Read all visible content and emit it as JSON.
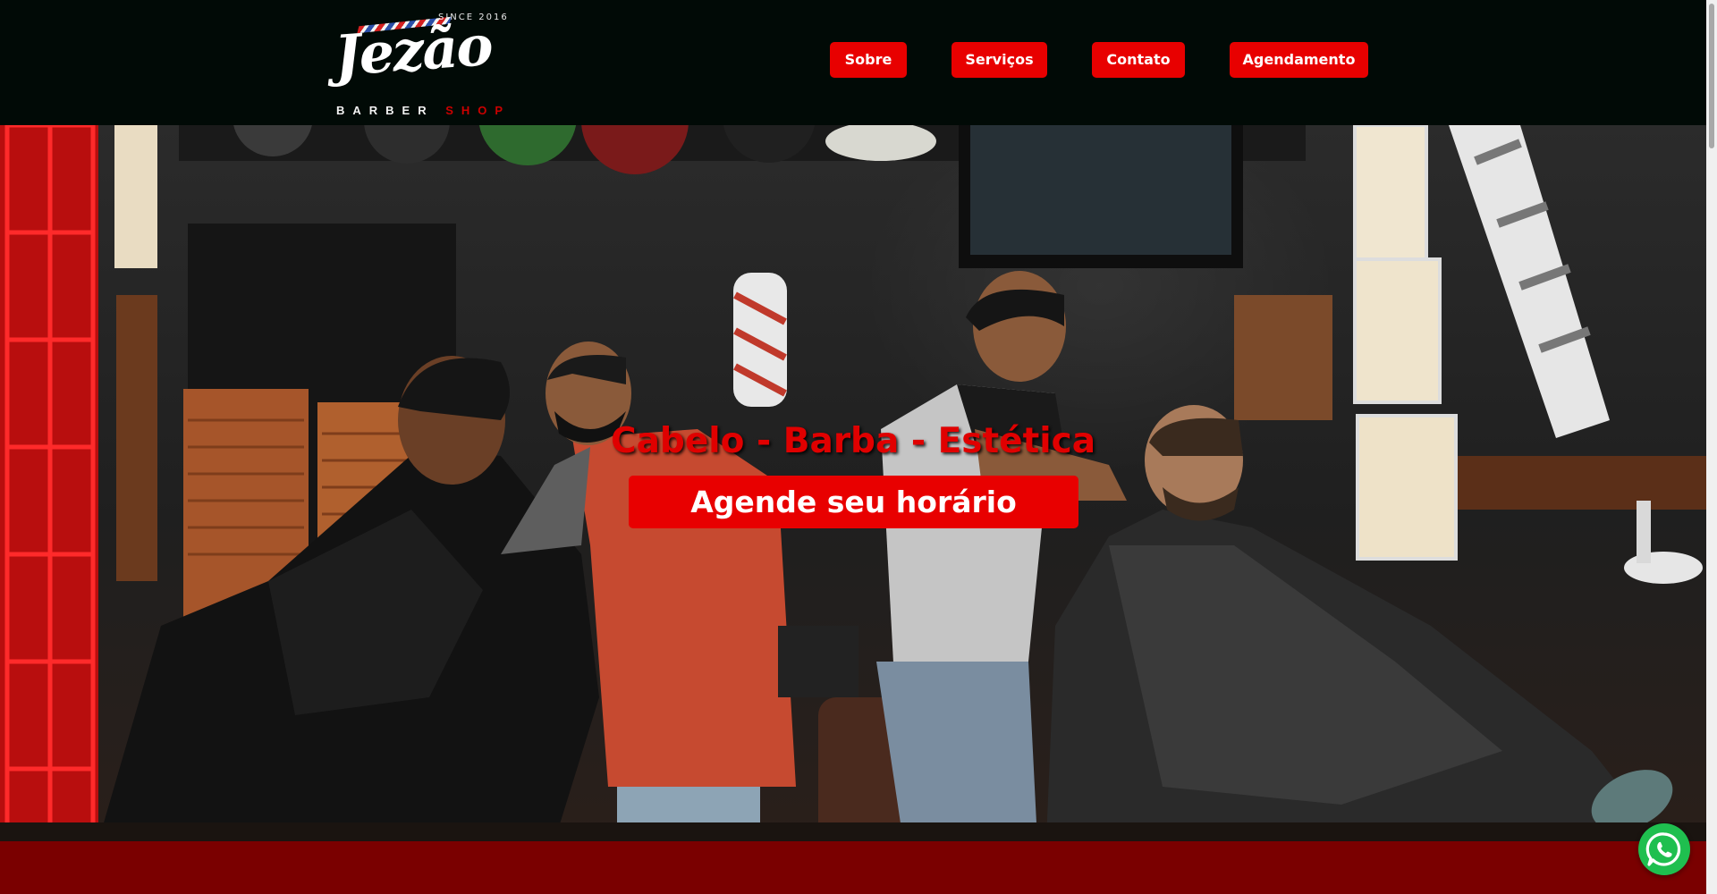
{
  "brand": {
    "logo_text": "Jezão",
    "since_text": "SINCE 2016",
    "barber_text": "BARBER",
    "shop_text": "SHOP"
  },
  "nav": {
    "items": [
      {
        "label": "Sobre"
      },
      {
        "label": "Serviços"
      },
      {
        "label": "Contato"
      },
      {
        "label": "Agendamento"
      }
    ]
  },
  "hero": {
    "title": "Cabelo - Barba - Estética",
    "cta_label": "Agende seu horário",
    "background": "barbershop-photo"
  },
  "widgets": {
    "whatsapp_icon": "whatsapp-icon"
  },
  "colors": {
    "header_bg": "#010a06",
    "accent_red": "#e80000",
    "band_red": "#7a0000",
    "whatsapp_green": "#1fbf4f"
  }
}
